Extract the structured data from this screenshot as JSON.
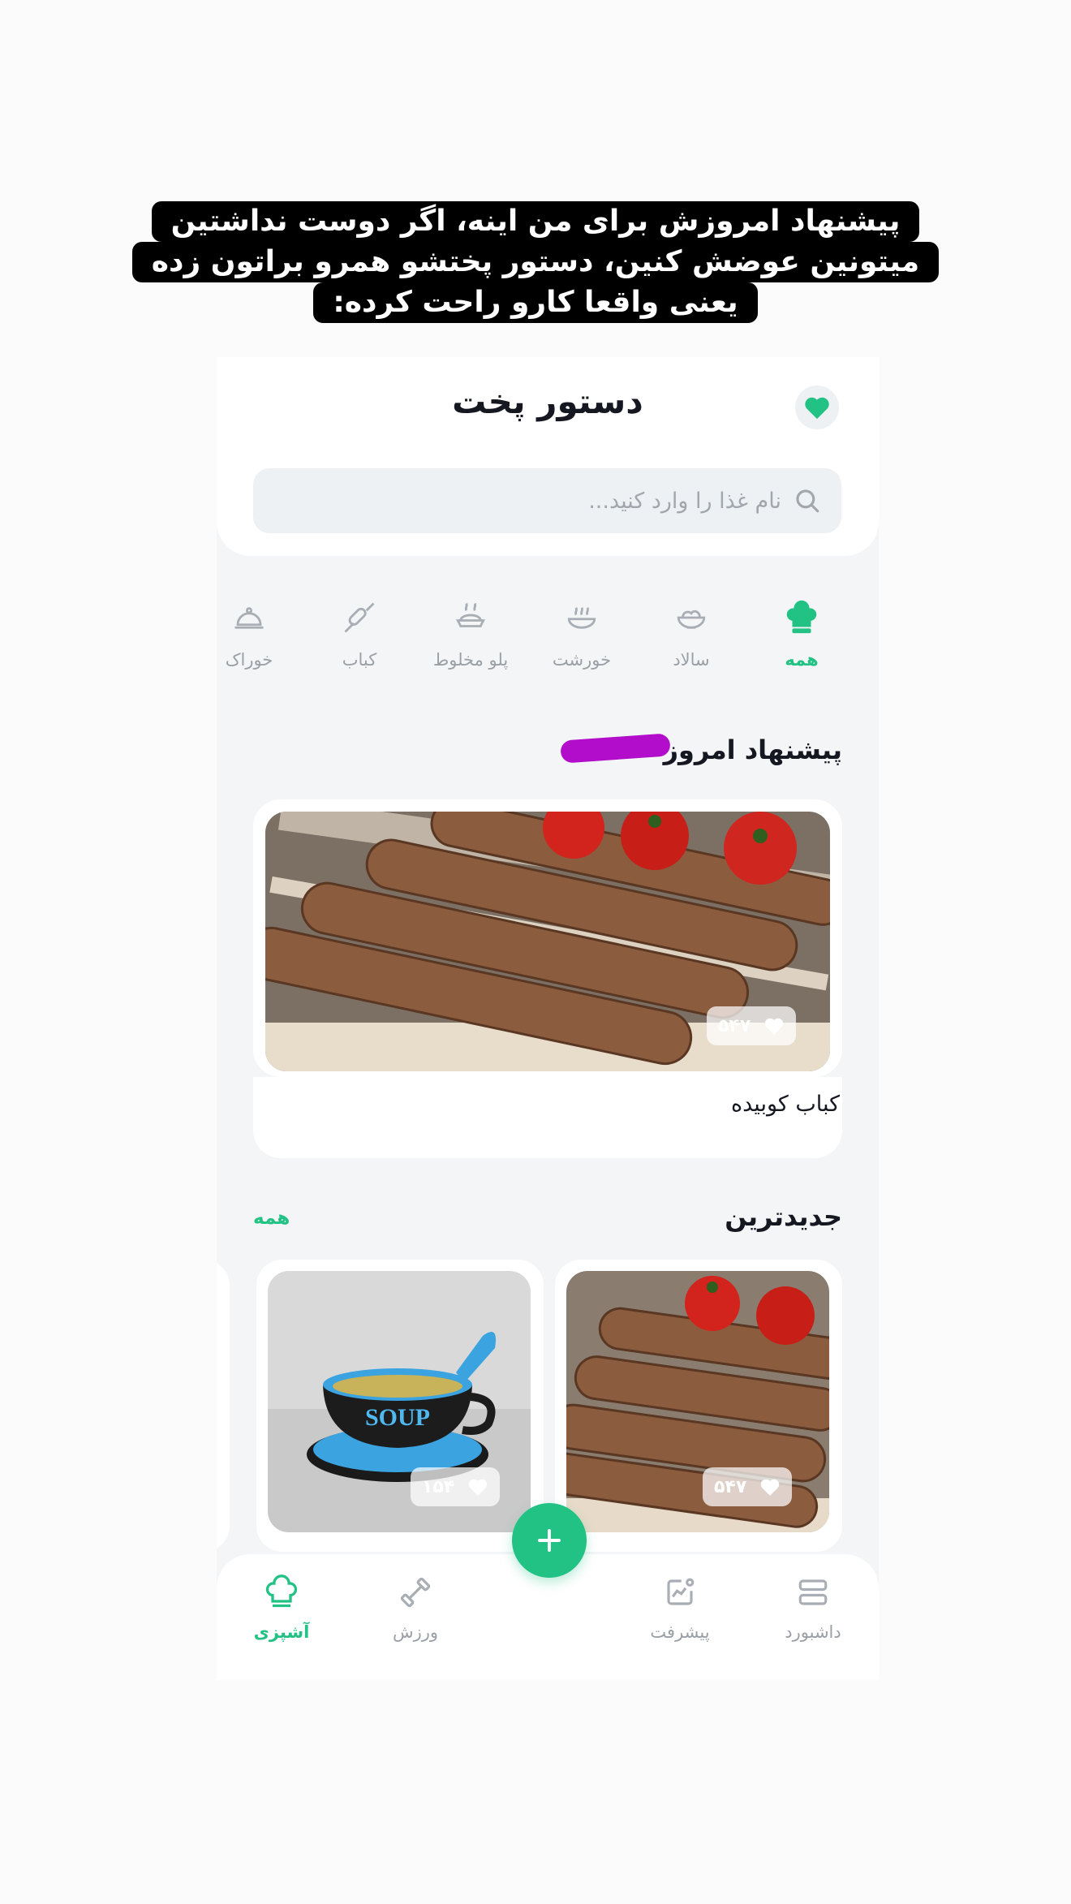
{
  "caption": {
    "lines": [
      "پیشنهاد امروزش برای من اینه، اگر دوست نداشتین",
      "میتونین عوضش کنین، دستور پختشو همرو براتون زده",
      "یعنی واقعا کارو راحت کرده:"
    ]
  },
  "header": {
    "title": "دستور پخت",
    "favorite_icon": "heart-icon"
  },
  "search": {
    "placeholder": "نام غذا را وارد کنید..."
  },
  "categories": [
    {
      "label": "همه",
      "icon": "chef-hat-icon",
      "active": true
    },
    {
      "label": "سالاد",
      "icon": "salad-bowl-icon"
    },
    {
      "label": "خورشت",
      "icon": "stew-pot-icon"
    },
    {
      "label": "پلو مخلوط",
      "icon": "rice-dish-icon"
    },
    {
      "label": "کباب",
      "icon": "skewer-icon"
    },
    {
      "label": "خوراک",
      "icon": "cloche-icon"
    }
  ],
  "today": {
    "title": "پیشنهاد امروز",
    "recipe": {
      "name": "کباب کوبیده",
      "likes": "۵۴۷"
    }
  },
  "newest": {
    "title": "جدیدترین",
    "see_all": "همه",
    "items": [
      {
        "likes": "۵۴۷",
        "image": "kebab-photo"
      },
      {
        "likes": "۱۵۴",
        "image": "soup-cup-photo",
        "cup_text": "SOUP"
      }
    ]
  },
  "nav": {
    "items": [
      {
        "label": "آشپزی",
        "icon": "chef-hat-icon",
        "active": true
      },
      {
        "label": "ورزش",
        "icon": "dumbbell-icon"
      },
      {
        "label": "پیشرفت",
        "icon": "progress-chart-icon"
      },
      {
        "label": "داشبورد",
        "icon": "dashboard-icon"
      }
    ],
    "fab_icon": "plus-icon"
  },
  "colors": {
    "accent": "#22c184",
    "marker": "#b20dca",
    "background": "#f4f5f7"
  }
}
